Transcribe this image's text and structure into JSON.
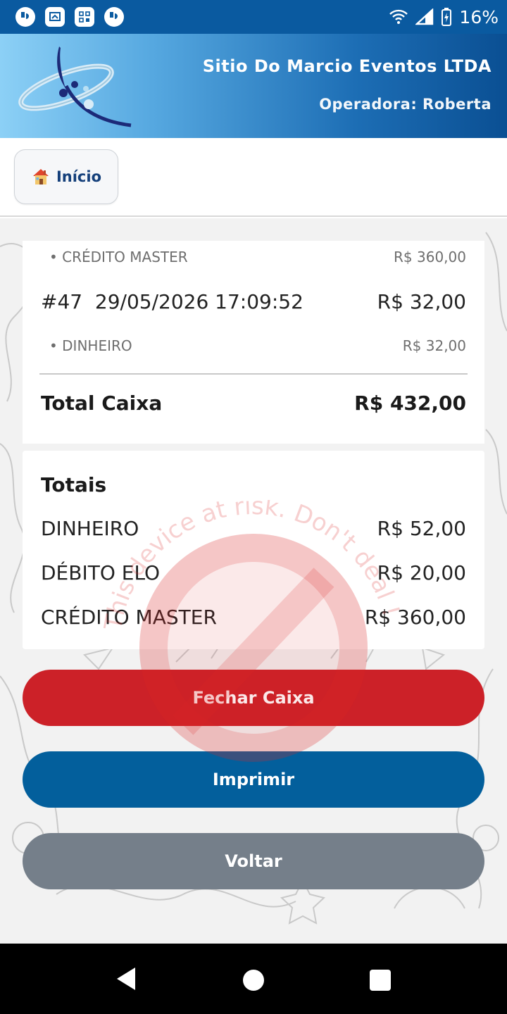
{
  "status_bar": {
    "battery_percent": "16%",
    "icons": [
      "app-notification-icon",
      "screen-cast-icon",
      "qr-code-icon",
      "app-notification-icon",
      "wifi-icon",
      "cell-signal-icon",
      "battery-charging-icon"
    ]
  },
  "header": {
    "company": "Sitio Do Marcio Eventos LTDA",
    "operator": "Operadora: Roberta"
  },
  "nav": {
    "home_label": "Início"
  },
  "summary": {
    "entries": [
      {
        "kind": "sub",
        "label": "• CRÉDITO MASTER",
        "value": "R$ 360,00"
      },
      {
        "kind": "main",
        "label": "#47  29/05/2026 17:09:52",
        "value": "R$ 32,00"
      },
      {
        "kind": "sub",
        "label": "• DINHEIRO",
        "value": "R$ 32,00"
      }
    ],
    "total_label": "Total Caixa",
    "total_value": "R$ 432,00"
  },
  "totals": {
    "title": "Totais",
    "rows": [
      {
        "label": "DINHEIRO",
        "value": "R$ 52,00"
      },
      {
        "label": "DÉBITO ELO",
        "value": "R$ 20,00"
      },
      {
        "label": "CRÉDITO MASTER",
        "value": "R$ 360,00"
      }
    ]
  },
  "actions": {
    "close_register": "Fechar Caixa",
    "print": "Imprimir",
    "back": "Voltar"
  },
  "overlay": {
    "warning_text": "This device at risk. Don't deal !"
  },
  "colors": {
    "status_bar": "#0a5aa0",
    "primary_red": "#cc2128",
    "primary_blue": "#035f9c",
    "neutral_gray": "#757f8a"
  }
}
